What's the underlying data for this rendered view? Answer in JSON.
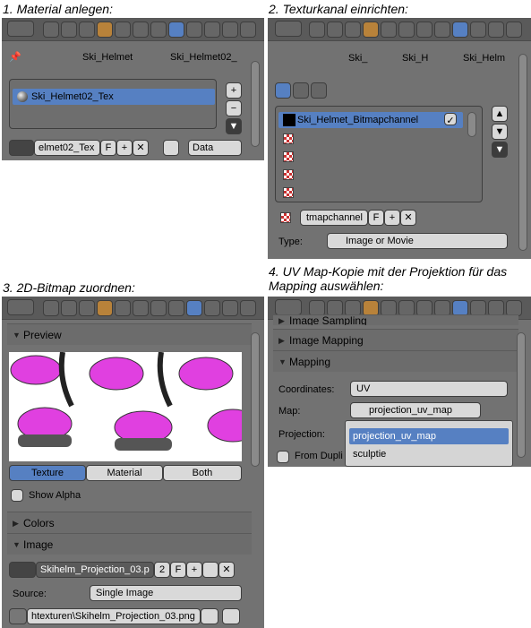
{
  "captions": {
    "c1": "1. Material anlegen:",
    "c2": "2. Texturkanal einrichten:",
    "c3": "3. 2D-Bitmap zuordnen:",
    "c4_line1": "4. UV Map-Kopie mit der Projektion für das",
    "c4_line2": "Mapping auswählen:"
  },
  "p1": {
    "breadcrumb1": "Ski_Helmet",
    "breadcrumb2": "Ski_Helmet02_",
    "list_item": "Ski_Helmet02_Tex",
    "name_field": "elmet02_Tex",
    "f_label": "F",
    "data_label": "Data"
  },
  "p2": {
    "breadcrumb1": "Ski_",
    "breadcrumb2": "Ski_H",
    "breadcrumb3": "Ski_Helm",
    "list_item": "Ski_Helmet_Bitmapchannel",
    "name_field": "tmapchannel",
    "f_label": "F",
    "type_label": "Type:",
    "type_value": "Image or Movie"
  },
  "p3": {
    "preview_label": "Preview",
    "tab_texture": "Texture",
    "tab_material": "Material",
    "tab_both": "Both",
    "show_alpha": "Show Alpha",
    "colors_label": "Colors",
    "image_label": "Image",
    "image_name": "Skihelm_Projection_03.p",
    "users": "2",
    "f_label": "F",
    "source_label": "Source:",
    "source_value": "Single Image",
    "path_value": "htexturen\\Skihelm_Projection_03.png"
  },
  "p4": {
    "image_sampling": "Image Sampling",
    "image_mapping": "Image Mapping",
    "mapping": "Mapping",
    "coordinates_label": "Coordinates:",
    "coordinates_value": "UV",
    "map_label": "Map:",
    "map_value": "projection_uv_map",
    "projection_label": "Projection:",
    "from_dupli": "From Dupli",
    "options": [
      "projection_uv_map",
      "sculptie"
    ]
  }
}
